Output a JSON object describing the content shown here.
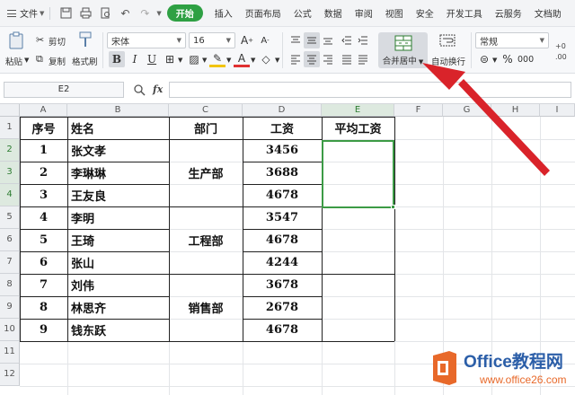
{
  "menubar": {
    "file_label": "文件",
    "tabs": [
      "插入",
      "页面布局",
      "公式",
      "数据",
      "审阅",
      "视图",
      "安全",
      "开发工具",
      "云服务",
      "文档助"
    ],
    "start_tab": "开始"
  },
  "ribbon": {
    "paste_label": "粘贴",
    "cut_label": "剪切",
    "copy_label": "复制",
    "format_painter_label": "格式刷",
    "font_name": "宋体",
    "font_size": "16",
    "merge_center_label": "合并居中",
    "wrap_text_label": "自动换行",
    "number_format": "常规",
    "percent": "%",
    "thousands": "000"
  },
  "formula_bar": {
    "cell_ref": "E2",
    "fx_label": "fx",
    "value": ""
  },
  "grid": {
    "columns": [
      "A",
      "B",
      "C",
      "D",
      "E",
      "F",
      "G",
      "H",
      "I"
    ],
    "rows": [
      "1",
      "2",
      "3",
      "4",
      "5",
      "6",
      "7",
      "8",
      "9",
      "10",
      "11",
      "12"
    ],
    "headers": {
      "seq": "序号",
      "name": "姓名",
      "dept": "部门",
      "salary": "工资",
      "avg": "平均工资"
    },
    "records": [
      {
        "seq": "1",
        "name": "张文孝",
        "salary": "3456"
      },
      {
        "seq": "2",
        "name": "李琳琳",
        "salary": "3688"
      },
      {
        "seq": "3",
        "name": "王友良",
        "salary": "4678"
      },
      {
        "seq": "4",
        "name": "李明",
        "salary": "3547"
      },
      {
        "seq": "5",
        "name": "王琦",
        "salary": "4678"
      },
      {
        "seq": "6",
        "name": "张山",
        "salary": "4244"
      },
      {
        "seq": "7",
        "name": "刘伟",
        "salary": "3678"
      },
      {
        "seq": "8",
        "name": "林思齐",
        "salary": "2678"
      },
      {
        "seq": "9",
        "name": "钱东跃",
        "salary": "4678"
      }
    ],
    "departments": [
      "生产部",
      "工程部",
      "销售部"
    ]
  },
  "watermark": {
    "brand": "Office教程网",
    "url": "www.office26.com"
  },
  "colors": {
    "accent_green": "#2ea043",
    "selection_green": "#3c9b45",
    "arrow_red": "#d9232a"
  }
}
